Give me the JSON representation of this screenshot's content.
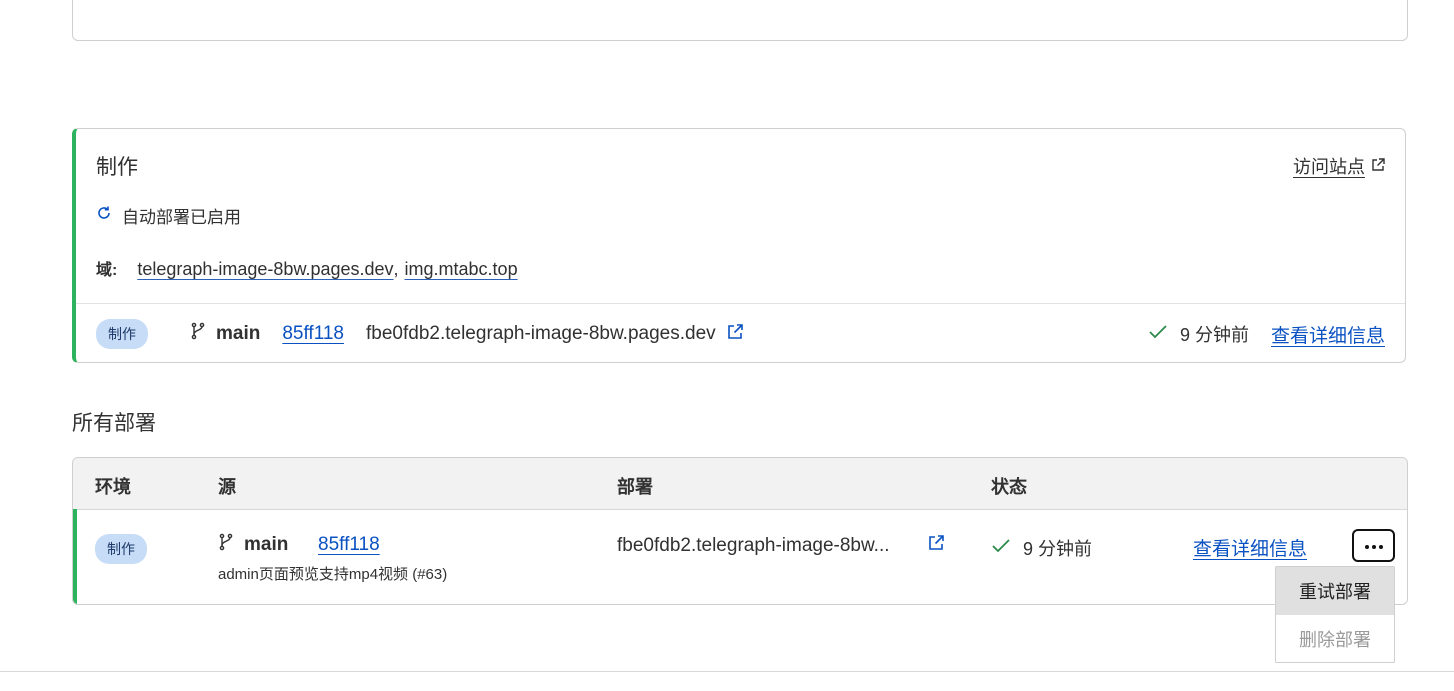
{
  "production": {
    "title": "制作",
    "visit_site": "访问站点",
    "auto_deploy": "自动部署已启用",
    "domains_label": "域:",
    "domains": [
      "telegraph-image-8bw.pages.dev",
      "img.mtabc.top"
    ],
    "domain_separator": ",",
    "badge": "制作",
    "branch": "main",
    "commit": "85ff118",
    "deploy_url": "fbe0fdb2.telegraph-image-8bw.pages.dev",
    "status_time": "9 分钟前",
    "details": "查看详细信息"
  },
  "all_deployments": {
    "title": "所有部署",
    "columns": [
      "环境",
      "源",
      "部署",
      "状态"
    ],
    "rows": [
      {
        "env": "制作",
        "branch": "main",
        "commit": "85ff118",
        "message": "admin页面预览支持mp4视频 (#63)",
        "deploy_url": "fbe0fdb2.telegraph-image-8bw...",
        "status_time": "9 分钟前",
        "details": "查看详细信息"
      }
    ]
  },
  "menu": {
    "items": [
      {
        "label": "重试部署",
        "state": "hover"
      },
      {
        "label": "删除部署",
        "state": "disabled"
      }
    ]
  },
  "icons": {
    "refresh": "refresh-icon",
    "branch": "git-branch-icon",
    "external": "external-link-icon",
    "check": "check-icon",
    "more": "more-horizontal-icon"
  },
  "colors": {
    "accent_green": "#2db35d",
    "link_blue": "#0a51c2",
    "badge_bg": "#c7dcf6"
  }
}
